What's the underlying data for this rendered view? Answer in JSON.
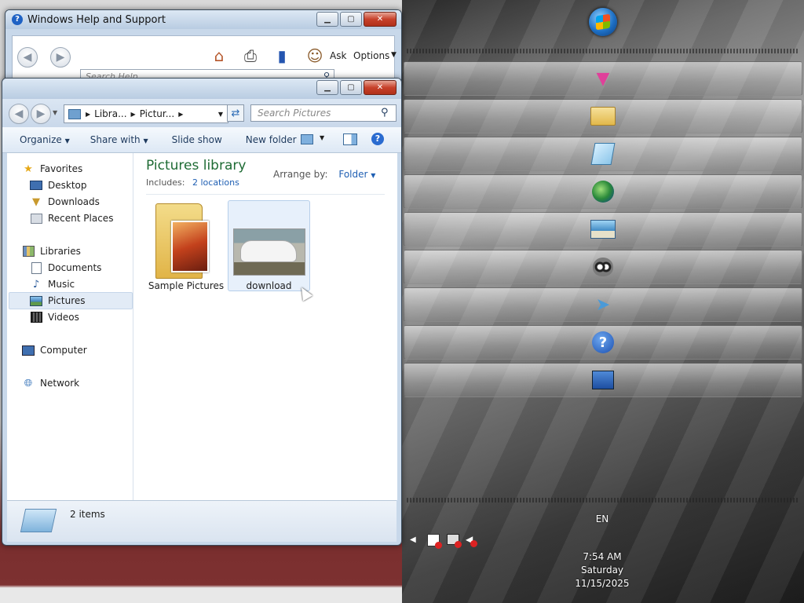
{
  "help_window": {
    "title": "Windows Help and Support",
    "ask_label": "Ask",
    "options_label": "Options",
    "search_placeholder": "Search Help"
  },
  "explorer": {
    "breadcrumb": [
      "Libra...",
      "Pictur..."
    ],
    "search_placeholder": "Search Pictures",
    "toolbar": {
      "organize": "Organize",
      "share_with": "Share with",
      "slide_show": "Slide show",
      "new_folder": "New folder"
    },
    "nav": {
      "favorites": "Favorites",
      "desktop": "Desktop",
      "downloads": "Downloads",
      "recent_places": "Recent Places",
      "libraries": "Libraries",
      "documents": "Documents",
      "music": "Music",
      "pictures": "Pictures",
      "videos": "Videos",
      "computer": "Computer",
      "network": "Network"
    },
    "library": {
      "title": "Pictures library",
      "includes_label": "Includes:",
      "includes_link": "2 locations",
      "arrange_label": "Arrange by:",
      "arrange_value": "Folder"
    },
    "items": [
      {
        "label": "Sample Pictures"
      },
      {
        "label": "download"
      }
    ],
    "status": "2 items"
  },
  "tray": {
    "language": "EN",
    "time": "7:54 AM",
    "day": "Saturday",
    "date": "11/15/2025"
  },
  "icons": {
    "start": "windows-orb-icon",
    "dock": [
      "pink-cat-icon",
      "folder-icon",
      "notepad-icon",
      "browser-globe-icon",
      "picture-viewer-icon",
      "raccoon-icon",
      "paper-plane-icon",
      "help-icon",
      "remote-desktop-icon"
    ]
  }
}
